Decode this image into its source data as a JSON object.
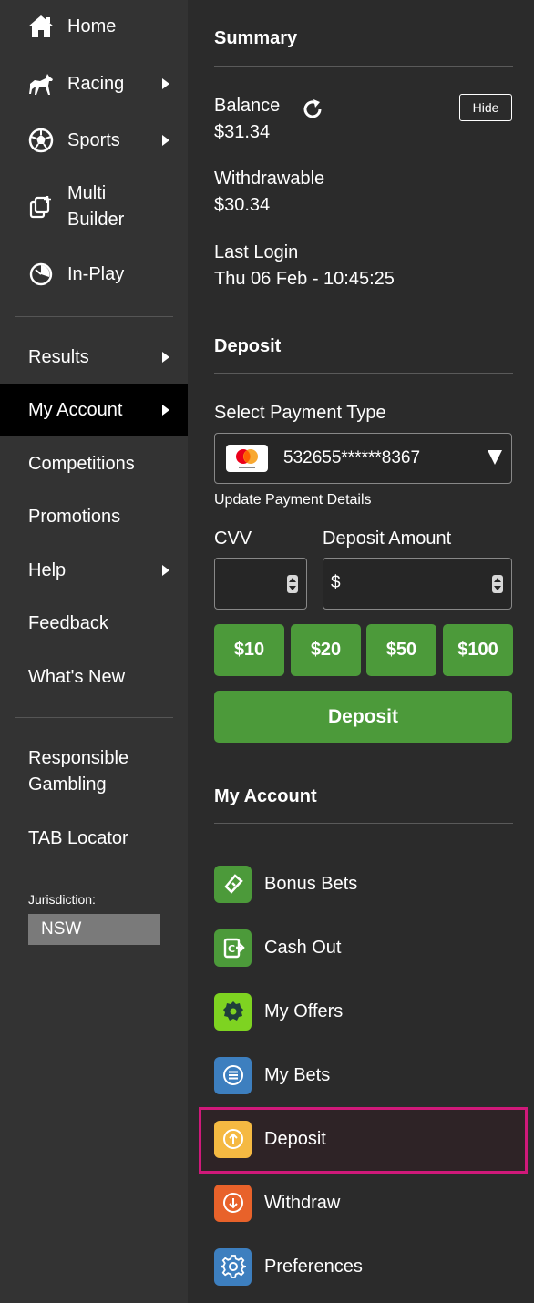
{
  "sidebar": {
    "primary_items": [
      {
        "label": "Home",
        "icon": "home-icon"
      },
      {
        "label": "Racing",
        "icon": "horse-icon"
      },
      {
        "label": "Sports",
        "icon": "soccer-ball-icon"
      },
      {
        "label": "Multi Builder",
        "label_line1": "Multi",
        "label_line2": "Builder",
        "icon": "multi-builder-icon"
      },
      {
        "label": "In-Play",
        "icon": "stopwatch-icon"
      }
    ],
    "secondary_items": [
      {
        "label": "Results"
      },
      {
        "label": "My Account"
      },
      {
        "label": "Competitions"
      },
      {
        "label": "Promotions"
      },
      {
        "label": "Help"
      },
      {
        "label": "Feedback"
      },
      {
        "label": "What's New"
      }
    ],
    "tertiary_items": [
      {
        "label": "Responsible Gambling",
        "label_line1": "Responsible",
        "label_line2": "Gambling"
      },
      {
        "label": "TAB Locator"
      }
    ],
    "jurisdiction_label": "Jurisdiction:",
    "jurisdiction_value": "NSW",
    "active_item": "My Account"
  },
  "summary": {
    "title": "Summary",
    "balance_label": "Balance",
    "balance_value": "$31.34",
    "hide_label": "Hide",
    "withdrawable_label": "Withdrawable",
    "withdrawable_value": "$30.34",
    "last_login_label": "Last Login",
    "last_login_value": "Thu 06 Feb - 10:45:25"
  },
  "deposit": {
    "title": "Deposit",
    "payment_type_label": "Select Payment Type",
    "payment_selected": "532655******8367",
    "update_payment_link": "Update Payment Details",
    "cvv_label": "CVV",
    "amount_label": "Deposit Amount",
    "amount_prefix": "$",
    "quick_amounts": [
      "$10",
      "$20",
      "$50",
      "$100"
    ],
    "submit_label": "Deposit"
  },
  "my_account": {
    "title": "My Account",
    "items": [
      {
        "label": "Bonus Bets",
        "icon": "bonus-ticket-icon",
        "color": "#4c9a3a"
      },
      {
        "label": "Cash Out",
        "icon": "cash-out-icon",
        "color": "#4c9a3a"
      },
      {
        "label": "My Offers",
        "icon": "offers-badge-icon",
        "color": "#7ed321"
      },
      {
        "label": "My Bets",
        "icon": "list-icon",
        "color": "#3d7fbf"
      },
      {
        "label": "Deposit",
        "icon": "arrow-up-circle-icon",
        "color": "#f5b942"
      },
      {
        "label": "Withdraw",
        "icon": "arrow-down-circle-icon",
        "color": "#e8622a"
      },
      {
        "label": "Preferences",
        "icon": "gear-icon",
        "color": "#3d7fbf"
      }
    ],
    "highlight_color": "#d0197a"
  }
}
